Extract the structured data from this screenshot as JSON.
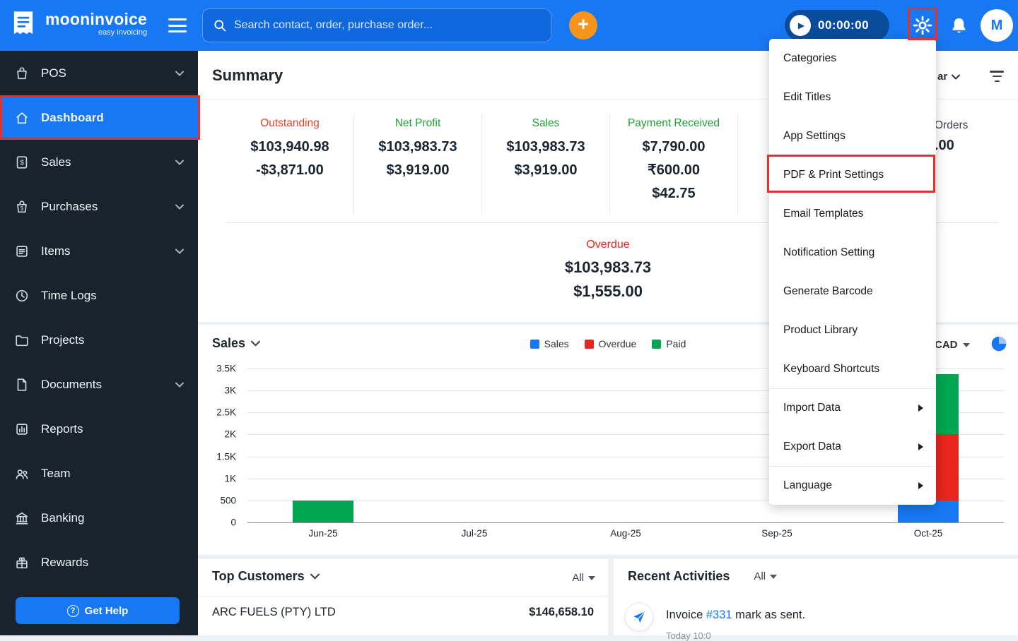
{
  "colors": {
    "topbar_blue": "#1877f2",
    "accent_orange": "#f7941e",
    "negative_red": "#e8402a",
    "positive_green": "#21a038",
    "overdue_red": "#e8251f",
    "annotation_red": "#e63226"
  },
  "icons": {
    "topbar": [
      "mooninvoice-logo",
      "hamburger-icon",
      "search-icon",
      "plus-icon",
      "play-icon",
      "gear-icon",
      "bell-icon"
    ],
    "sidebar": [
      "pos-icon",
      "home-icon",
      "sales-icon",
      "purchases-icon",
      "items-icon",
      "clock-icon",
      "folder-icon",
      "document-icon",
      "reports-icon",
      "team-icon",
      "bank-icon",
      "gift-icon",
      "question-icon"
    ],
    "content": [
      "chevron-down-icon",
      "filter-icon",
      "pie-chart-icon",
      "caret-down-icon",
      "send-icon",
      "submenu-arrow-icon"
    ]
  },
  "topbar": {
    "brand": "mooninvoice",
    "tagline": "easy invoicing",
    "search_placeholder": "Search contact, order, purchase order...",
    "timer": "00:00:00",
    "avatar_initial": "M"
  },
  "sidebar": {
    "items": [
      {
        "label": "POS"
      },
      {
        "label": "Dashboard"
      },
      {
        "label": "Sales"
      },
      {
        "label": "Purchases"
      },
      {
        "label": "Items"
      },
      {
        "label": "Time Logs"
      },
      {
        "label": "Projects"
      },
      {
        "label": "Documents"
      },
      {
        "label": "Reports"
      },
      {
        "label": "Team"
      },
      {
        "label": "Banking"
      },
      {
        "label": "Rewards"
      }
    ],
    "help_label": "Get Help"
  },
  "summary": {
    "title": "Summary",
    "period_partial": "ar",
    "stats": [
      {
        "label": "Outstanding",
        "label_color": "#e8402a",
        "values": [
          "$103,940.98",
          "-$3,871.00"
        ]
      },
      {
        "label": "Net Profit",
        "label_color": "#21a038",
        "values": [
          "$103,983.73",
          "$3,919.00"
        ]
      },
      {
        "label": "Sales",
        "label_color": "#21a038",
        "values": [
          "$103,983.73",
          "$3,919.00"
        ]
      },
      {
        "label": "Payment Received",
        "label_color": "#21a038",
        "values": [
          "$7,790.00",
          "₹600.00",
          "$42.75"
        ]
      }
    ],
    "partial_stat": {
      "label": "Orders",
      "value": ".00"
    },
    "overdue": {
      "label": "Overdue",
      "label_color": "#e8251f",
      "values": [
        "$103,983.73",
        "$1,555.00"
      ]
    }
  },
  "chart_data": {
    "type": "bar",
    "stacked": true,
    "title": "Sales",
    "currency": "CAD",
    "categories": [
      "Jun-25",
      "Jul-25",
      "Aug-25",
      "Sep-25",
      "Oct-25"
    ],
    "series": [
      {
        "name": "Sales",
        "color": "#1877f2",
        "values": [
          0,
          0,
          0,
          0,
          500
        ]
      },
      {
        "name": "Overdue",
        "color": "#e8251f",
        "values": [
          0,
          0,
          0,
          0,
          1500
        ]
      },
      {
        "name": "Paid",
        "color": "#00a651",
        "values": [
          500,
          0,
          0,
          0,
          1370
        ]
      }
    ],
    "ylim": [
      0,
      3500
    ],
    "yticks": [
      {
        "value": 0,
        "label": "0"
      },
      {
        "value": 500,
        "label": "500"
      },
      {
        "value": 1000,
        "label": "1K"
      },
      {
        "value": 1500,
        "label": "1.5K"
      },
      {
        "value": 2000,
        "label": "2K"
      },
      {
        "value": 2500,
        "label": "2.5K"
      },
      {
        "value": 3000,
        "label": "3K"
      },
      {
        "value": 3500,
        "label": "3.5K"
      }
    ],
    "legend_position": "top-center",
    "grid": true
  },
  "settings_menu": {
    "items": [
      {
        "label": "Categories"
      },
      {
        "label": "Edit Titles"
      },
      {
        "label": "App Settings"
      },
      {
        "label": "PDF & Print Settings",
        "highlighted": true
      },
      {
        "label": "Email Templates"
      },
      {
        "label": "Notification Setting"
      },
      {
        "label": "Generate Barcode"
      },
      {
        "label": "Product Library"
      },
      {
        "label": "Keyboard Shortcuts"
      },
      {
        "label": "Import Data",
        "submenu": true
      },
      {
        "label": "Export Data",
        "submenu": true
      },
      {
        "label": "Language",
        "submenu": true
      }
    ]
  },
  "top_customers": {
    "title": "Top Customers",
    "filter": "All",
    "rows": [
      {
        "name": "ARC FUELS (PTY) LTD",
        "amount": "$146,658.10"
      }
    ]
  },
  "recent_activities": {
    "title": "Recent Activities",
    "filter": "All",
    "rows": [
      {
        "prefix": "Invoice ",
        "link": "#331",
        "suffix": " mark as sent.",
        "meta_partial": "Today 10:0"
      }
    ]
  }
}
